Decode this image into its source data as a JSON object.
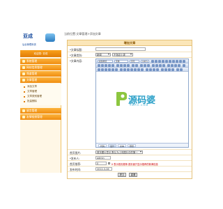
{
  "app": {
    "logo_text": "亚成",
    "logo_sub": "后台管理系统",
    "user_bar": "欢迎您: 亚成"
  },
  "breadcrumb": "当前位置:文章管理>添加文章",
  "sidebar": {
    "items": [
      {
        "label": "系统管理"
      },
      {
        "label": "网站信息管理"
      },
      {
        "label": "频道管理"
      },
      {
        "label": "文章管理"
      }
    ],
    "sub_items": [
      {
        "label": "添加文章"
      },
      {
        "label": "文章管理"
      },
      {
        "label": "文章类别管理"
      },
      {
        "label": "批量删除"
      }
    ],
    "bottom_items": [
      {
        "label": "留言管理"
      },
      {
        "label": "友情链接管理"
      }
    ]
  },
  "form": {
    "title": "增加文章",
    "fields": {
      "title_label": "*文章标题:",
      "category_label": "*文章类别:",
      "category_value": "新闻",
      "category_sub_value": "不指定小类",
      "content_label": "*文章内容:",
      "cover_label": "首页图片:",
      "cover_value": "首页图片显示,默认为上传图片中的第一",
      "author_label": "*发布人:",
      "author_value": "admin",
      "home_label": "首页推荐:",
      "home_option": "0",
      "home_note": "0 表示首页推荐,首页面只显示推荐的新闻信息",
      "date_label": "发布时间:",
      "date_value": "2012-3-26"
    },
    "editor": {
      "font_style": "段落样式",
      "font_name": "字体",
      "font_size": "字号",
      "zoom": "100%",
      "tabs": [
        "代码",
        "设计",
        "文本",
        "预览"
      ],
      "active_tab": "设计",
      "watermark_text": "源码婆",
      "watermark_sub": "YMPO.COM"
    },
    "buttons": {
      "submit": "提交",
      "reset": "重置"
    }
  },
  "colors": {
    "accent": "#f08d10",
    "sidebar_bg": "#fff7e6",
    "panel_border": "#e6c27a"
  }
}
